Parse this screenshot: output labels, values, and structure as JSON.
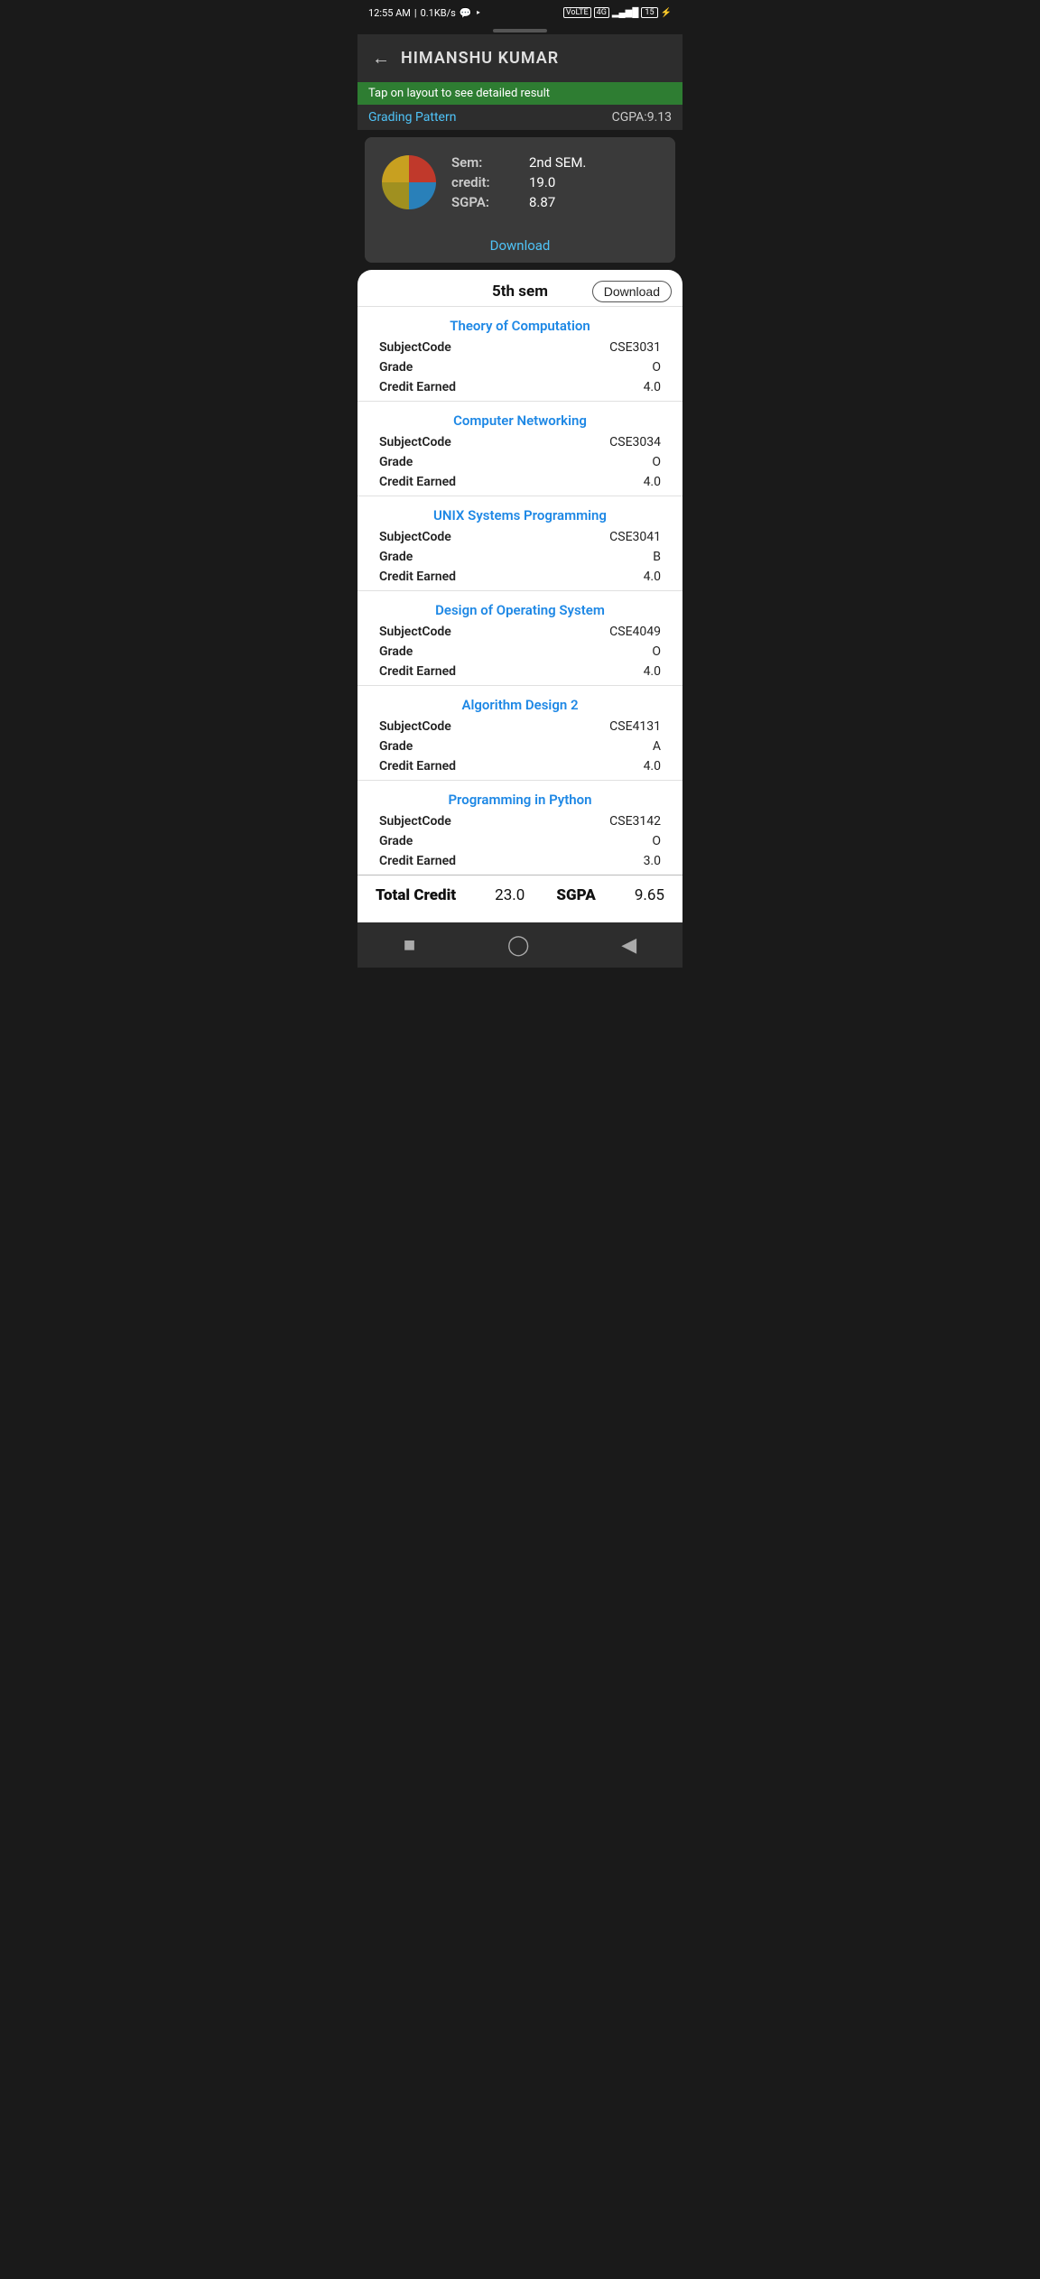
{
  "statusBar": {
    "time": "12:55 AM",
    "network": "0.1KB/s",
    "icons": [
      "whatsapp",
      "location"
    ],
    "rightIcons": [
      "volte",
      "4g",
      "signal",
      "battery15",
      "charging"
    ]
  },
  "header": {
    "backLabel": "←",
    "title": "HIMANSHU KUMAR"
  },
  "banner": {
    "text": "Tap on layout to see detailed result"
  },
  "cgpaRow": {
    "gradingPattern": "Grading Pattern",
    "cgpa": "CGPA:9.13"
  },
  "backgroundCard": {
    "sem": "2nd SEM.",
    "semLabel": "Sem:",
    "credit": "19.0",
    "creditLabel": "credit:",
    "sgpa": "8.87",
    "sgpaLabel": "SGPA:",
    "downloadLabel": "Download"
  },
  "modal": {
    "title": "5th sem",
    "downloadLabel": "Download",
    "subjects": [
      {
        "name": "Theory of Computation",
        "code": "CSE3031",
        "grade": "O",
        "creditEarned": "4.0"
      },
      {
        "name": "Computer Networking",
        "code": "CSE3034",
        "grade": "O",
        "creditEarned": "4.0"
      },
      {
        "name": "UNIX Systems Programming",
        "code": "CSE3041",
        "grade": "B",
        "creditEarned": "4.0"
      },
      {
        "name": "Design of Operating System",
        "code": "CSE4049",
        "grade": "O",
        "creditEarned": "4.0"
      },
      {
        "name": "Algorithm Design 2",
        "code": "CSE4131",
        "grade": "A",
        "creditEarned": "4.0"
      },
      {
        "name": "Programming in Python",
        "code": "CSE3142",
        "grade": "O",
        "creditEarned": "3.0"
      }
    ],
    "labels": {
      "subjectCode": "SubjectCode",
      "grade": "Grade",
      "creditEarned": "Credit Earned"
    },
    "footer": {
      "totalCreditLabel": "Total Credit",
      "totalCreditValue": "23.0",
      "sgpaLabel": "SGPA",
      "sgpaValue": "9.65"
    }
  },
  "bottomNav": {
    "icons": [
      "square",
      "circle",
      "triangle-left"
    ]
  }
}
